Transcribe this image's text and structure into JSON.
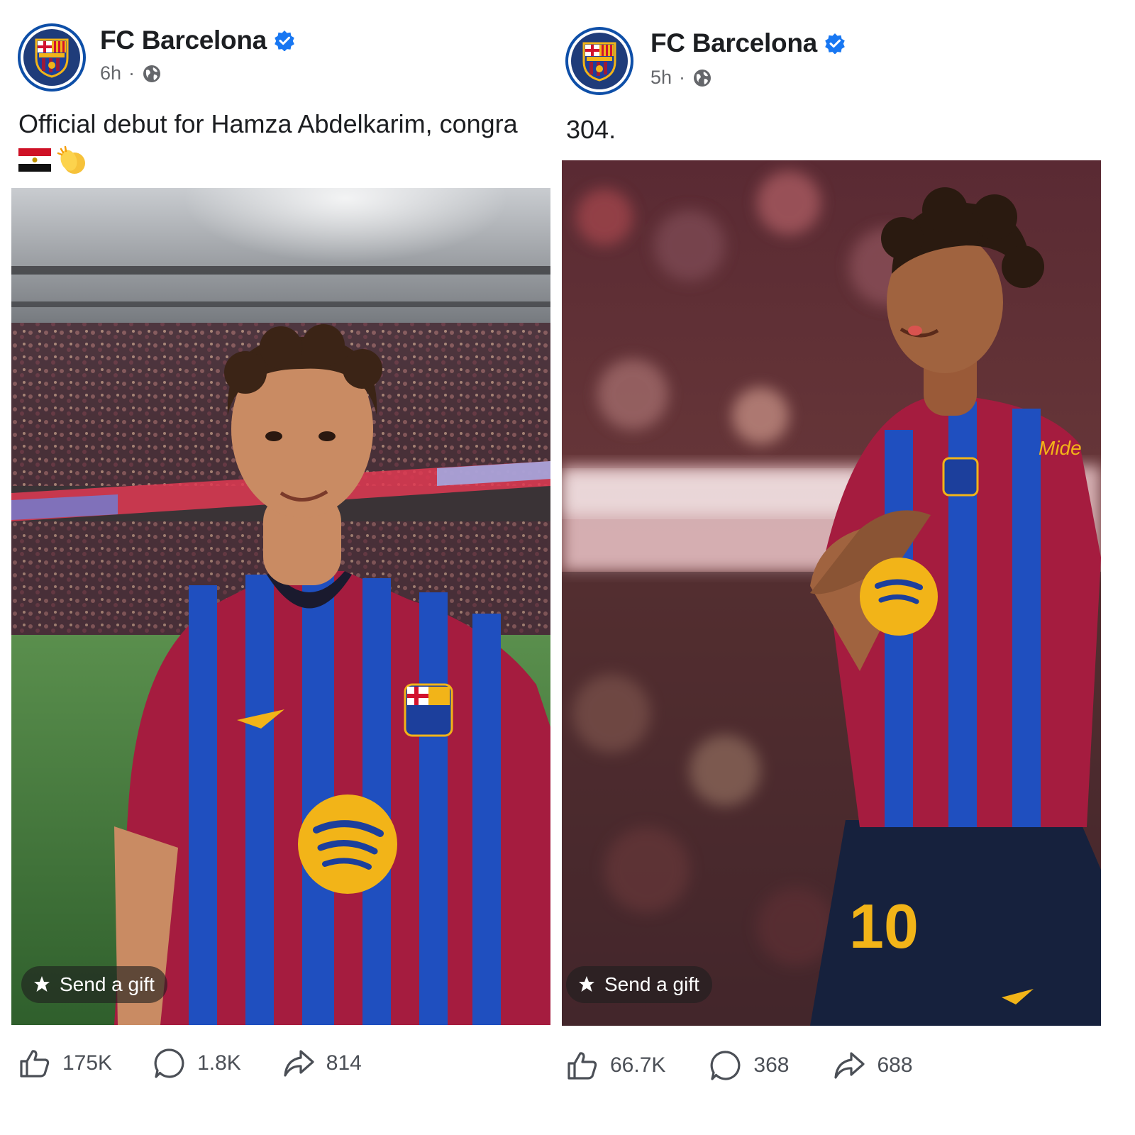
{
  "posts": [
    {
      "page_name": "FC Barcelona",
      "time": "6h",
      "separator": "·",
      "caption": "Official debut for Hamza Abdelkarim, congra",
      "emojis": [
        "egypt-flag",
        "clapping-hands"
      ],
      "gift_label": "Send a gift",
      "likes": "175K",
      "comments": "1.8K",
      "shares": "814"
    },
    {
      "page_name": "FC Barcelona",
      "time": "5h",
      "separator": "·",
      "caption": "304.",
      "gift_label": "Send a gift",
      "likes": "66.7K",
      "comments": "368",
      "shares": "688"
    }
  ],
  "colors": {
    "verified_blue": "#1877f2",
    "barca_blue": "#1c3f9c",
    "barca_red": "#9b1b3a",
    "sponsor_yellow": "#f2b418",
    "pitch_green": "#3f7a3a"
  }
}
